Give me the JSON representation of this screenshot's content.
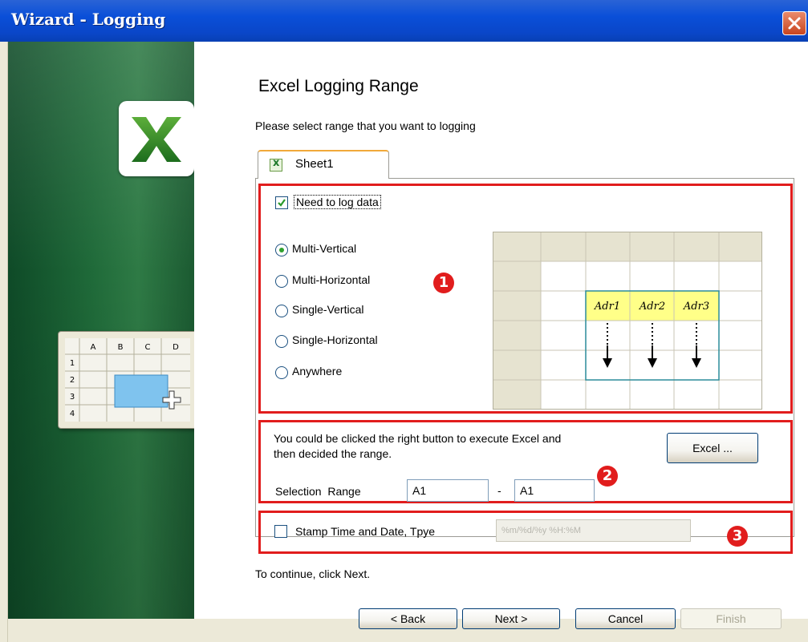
{
  "window": {
    "title": "Wizard - Logging"
  },
  "page": {
    "heading": "Excel Logging Range",
    "instruction": "Please select range that you want to logging"
  },
  "tab": {
    "label": "Sheet1"
  },
  "log_option": {
    "label": "Need to log data",
    "checked": true
  },
  "radio_options": [
    {
      "label": "Multi-Vertical",
      "selected": true
    },
    {
      "label": "Multi-Horizontal",
      "selected": false
    },
    {
      "label": "Single-Vertical",
      "selected": false
    },
    {
      "label": "Single-Horizontal",
      "selected": false
    },
    {
      "label": "Anywhere",
      "selected": false
    }
  ],
  "preview": {
    "addresses": [
      "Adr1",
      "Adr2",
      "Adr3"
    ]
  },
  "excel_section": {
    "description_line1": "You could be clicked the right button to execute Excel and",
    "description_line2": "then decided the range.",
    "excel_button": "Excel ...",
    "range_label": "Selection  Range",
    "range_from": "A1",
    "range_separator": "-",
    "range_to": "A1"
  },
  "stamp": {
    "label": "Stamp Time and Date, Tpye",
    "checked": false,
    "format": "%m/%d/%y %H:%M"
  },
  "badges": [
    "1",
    "2",
    "3"
  ],
  "continue_text": "To continue, click Next.",
  "buttons": {
    "back": "< Back",
    "next": "Next >",
    "cancel": "Cancel",
    "finish": "Finish"
  },
  "sidebar_icon": {
    "columns": [
      "A",
      "B",
      "C",
      "D"
    ],
    "rows": [
      "1",
      "2",
      "3",
      "4"
    ]
  },
  "colors": {
    "title_bar": "#0a46c8",
    "highlight": "#e11d1d",
    "address_fill": "#ffff88",
    "selection_fill": "#7fc3ee"
  }
}
